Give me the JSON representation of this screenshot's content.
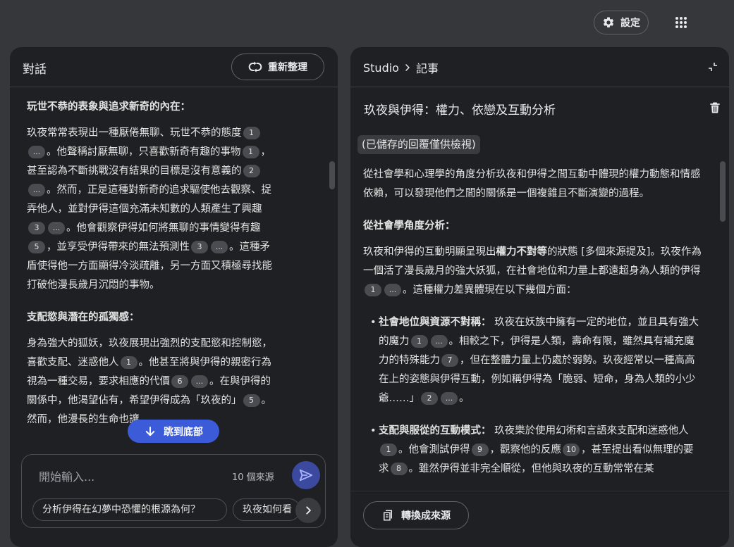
{
  "topbar": {
    "settings_label": "設定",
    "settings_icon": "gear-icon",
    "apps_icon": "apps-grid-icon"
  },
  "chat": {
    "title": "對話",
    "refresh_label": "重新整理",
    "sections": [
      {
        "heading": "玩世不恭的表象與追求新奇的內在：",
        "body": [
          "玖夜常常表現出一種厭倦無聊、玩世不恭的態度",
          {
            "cite": "1"
          },
          {
            "cite": "..."
          },
          "。他聲稱討厭無聊，只喜歡新奇有趣的事物",
          {
            "cite": "1"
          },
          "，甚至認為不斷挑戰沒有結果的目標是沒有意義的",
          {
            "cite": "2"
          },
          {
            "cite": "..."
          },
          "。然而，正是這種對新奇的追求驅使他去觀察、捉弄他人，並對伊得這個充滿未知數的人類產生了興趣",
          {
            "cite": "3"
          },
          {
            "cite": "..."
          },
          "。他會觀察伊得如何將無聊的事情變得有趣",
          {
            "cite": "5"
          },
          "，並享受伊得帶來的無法預測性",
          {
            "cite": "3"
          },
          {
            "cite": "..."
          },
          "。這種矛盾使得他一方面顯得冷淡疏離，另一方面又積極尋找能打破他漫長歲月沉悶的事物。"
        ]
      },
      {
        "heading": "支配慾與潛在的孤獨感：",
        "body": [
          "身為強大的狐妖，玖夜展現出強烈的支配慾和控制慾，喜歡支配、迷惑他人",
          {
            "cite": "1"
          },
          "。他甚至將與伊得的親密行為視為一種交易，要求相應的代價",
          {
            "cite": "6"
          },
          {
            "cite": "..."
          },
          "。在與伊得的關係中，他渴望佔有，希望伊得成為「玖夜的」",
          {
            "cite": "5"
          },
          "。然而，他漫長的生命也讓"
        ]
      }
    ],
    "jump_label": "跳到底部",
    "input": {
      "placeholder": "開始輸入...",
      "source_count": "10 個來源"
    },
    "suggestions": [
      "分析伊得在幻夢中恐懼的根源為何？",
      "玖夜如何看"
    ]
  },
  "studio": {
    "breadcrumb_root": "Studio",
    "breadcrumb_current": "記事",
    "note_title": "玖夜與伊得：權力、依戀及互動分析",
    "saved_badge": "(已儲存的回覆僅供檢視)",
    "intro": "從社會學和心理學的角度分析玖夜和伊得之間互動中體現的權力動態和情感依賴，可以發現他們之間的關係是一個複雜且不斷演變的過程。",
    "section_heading": "從社會學角度分析：",
    "para": [
      "玖夜和伊得的互動明顯呈現出",
      {
        "bold": "權力不對等"
      },
      "的狀態 [多個來源提及]。玖夜作為一個活了漫長歲月的強大妖狐，在社會地位和力量上都遠超身為人類的伊得",
      {
        "cite": "1"
      },
      {
        "cite": "..."
      },
      "。這種權力差異體現在以下幾個方面："
    ],
    "bullets": [
      [
        {
          "bold": "社會地位與資源不對稱："
        },
        " 玖夜在妖族中擁有一定的地位，並且具有強大的魔力",
        {
          "cite": "1"
        },
        {
          "cite": "..."
        },
        "。相較之下，伊得是人類，壽命有限，雖然具有補充魔力的特殊能力",
        {
          "cite": "7"
        },
        "，但在整體力量上仍處於弱勢。玖夜經常以一種高高在上的姿態與伊得互動，例如稱伊得為「脆弱、短命，身為人類的小少爺……」",
        {
          "cite": "2"
        },
        {
          "cite": "..."
        },
        "。"
      ],
      [
        {
          "bold": "支配與服從的互動模式："
        },
        " 玖夜樂於使用幻術和言語來支配和迷惑他人",
        {
          "cite": "1"
        },
        "。他會測試伊得",
        {
          "cite": "9"
        },
        "，觀察他的反應",
        {
          "cite": "10"
        },
        "，甚至提出看似無理的要求",
        {
          "cite": "8"
        },
        "。雖然伊得並非完全順從，但他與玖夜的互動常常在某"
      ]
    ],
    "convert_label": "轉換成來源",
    "delete_icon": "trash-icon"
  }
}
